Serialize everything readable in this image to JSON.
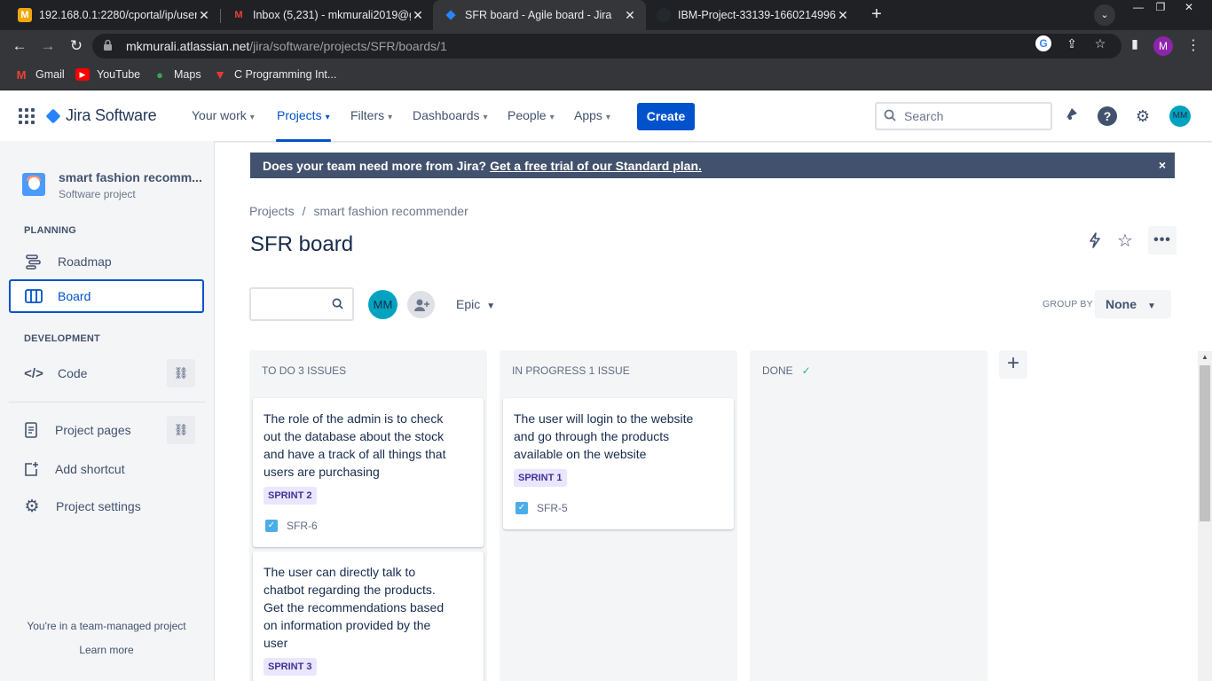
{
  "browser": {
    "tabs": [
      {
        "title": "192.168.0.1:2280/cportal/ip/user_",
        "favicon": "M"
      },
      {
        "title": "Inbox (5,231) - mkmurali2019@g",
        "favicon": "M"
      },
      {
        "title": "SFR board - Agile board - Jira",
        "favicon": "jira-icon"
      },
      {
        "title": "IBM-Project-33139-1660214996/",
        "favicon": "github-icon"
      }
    ],
    "url_host": "mkmurali.atlassian.net",
    "url_path": "/jira/software/projects/SFR/boards/1",
    "profile_initial": "M",
    "bookmarks": [
      "Gmail",
      "YouTube",
      "Maps",
      "C Programming Int..."
    ]
  },
  "jira_nav": {
    "product": "Jira Software",
    "items": [
      "Your work",
      "Projects",
      "Filters",
      "Dashboards",
      "People",
      "Apps"
    ],
    "selected": "Projects",
    "create_label": "Create",
    "search_placeholder": "Search",
    "avatar_initials": "MM"
  },
  "sidebar": {
    "project_name": "smart fashion recomm...",
    "project_type": "Software project",
    "planning_header": "PLANNING",
    "planning_items": [
      "Roadmap",
      "Board"
    ],
    "development_header": "DEVELOPMENT",
    "development_items": [
      "Code"
    ],
    "other_items": [
      "Project pages",
      "Add shortcut",
      "Project settings"
    ],
    "footer_text": "You're in a team-managed project",
    "footer_link": "Learn more"
  },
  "banner": {
    "text": "Does your team need more from Jira?",
    "link": "Get a free trial of our Standard plan.",
    "close": "×"
  },
  "breadcrumbs": [
    "Projects",
    "smart fashion recommender"
  ],
  "board": {
    "title": "SFR board",
    "filter_avatar": "MM",
    "epic_label": "Epic",
    "group_by_label": "GROUP BY",
    "group_by_value": "None",
    "columns": [
      {
        "header": "TO DO 3 ISSUES",
        "cards": [
          {
            "text": "The role of the admin is to check out the database about the stock and have a track of all things that users are purchasing",
            "sprint": "SPRINT 2",
            "key": "SFR-6"
          },
          {
            "text": "The user can directly talk to chatbot regarding the products. Get the recommendations based on information provided by the user",
            "sprint": "SPRINT 3",
            "key": ""
          }
        ]
      },
      {
        "header": "IN PROGRESS 1 ISSUE",
        "cards": [
          {
            "text": "The user will login to the website and go through the products available on the website",
            "sprint": "SPRINT 1",
            "key": "SFR-5"
          }
        ]
      },
      {
        "header": "DONE",
        "cards": []
      }
    ]
  },
  "colors": {
    "brand_blue": "#0052cc",
    "banner_bg": "#42526e",
    "sprint_lozenge": "#eae6ff",
    "story_icon": "#4bade8",
    "avatar": "#00a3bf"
  }
}
